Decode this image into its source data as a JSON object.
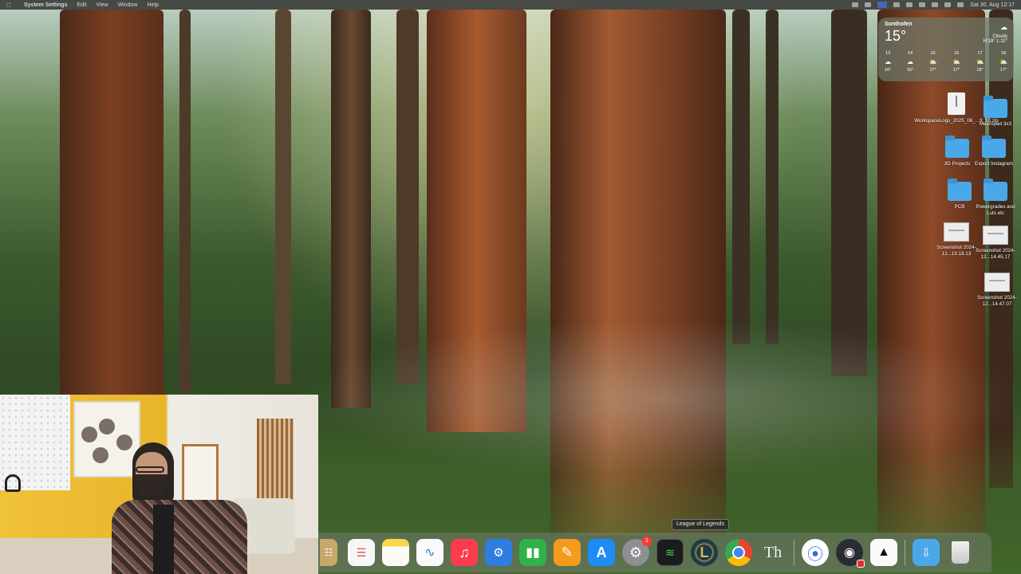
{
  "menubar": {
    "app_name": "System Settings",
    "items": [
      "Edit",
      "View",
      "Window",
      "Help"
    ],
    "clock": "Sat 30. Aug 12:17"
  },
  "weather": {
    "city": "Sonthofen",
    "temperature": "15°",
    "condition": "Cloudy",
    "high_low": "H:18° L:11°",
    "hours": [
      {
        "hour": "13",
        "temp": "16°"
      },
      {
        "hour": "14",
        "temp": "16°"
      },
      {
        "hour": "15",
        "temp": "17°"
      },
      {
        "hour": "16",
        "temp": "17°"
      },
      {
        "hour": "17",
        "temp": "18°"
      },
      {
        "hour": "18",
        "temp": "17°"
      }
    ]
  },
  "desktop": {
    "items": [
      {
        "label": "WorkspaceLogs_2025_06_...9_53.zip",
        "kind": "zip"
      },
      {
        "label": "Macropad 3x3",
        "kind": "folder"
      },
      {
        "label": "3D Projects",
        "kind": "folder"
      },
      {
        "label": "Export Instagram",
        "kind": "folder"
      },
      {
        "label": "PCB",
        "kind": "folder"
      },
      {
        "label": "Powergrades and Luts etc",
        "kind": "folder"
      },
      {
        "label": "Screenshot 2024-12...19.18.13",
        "kind": "screenshot"
      },
      {
        "label": "Screenshot 2024-12...14.45.17",
        "kind": "screenshot"
      },
      {
        "label": "Screenshot 2024-12...14.47.07",
        "kind": "screenshot"
      }
    ]
  },
  "dock": {
    "tooltip": "League of Legends",
    "settings_badge": "1",
    "textedit_glyph": "Th",
    "colors": {
      "music": "#fa3c4c",
      "keynote": "#2f7de1",
      "numbers": "#30b24a",
      "pages": "#f49a1c",
      "appstore": "#1d8df5",
      "finder_folder": "#4aa8e8"
    }
  }
}
